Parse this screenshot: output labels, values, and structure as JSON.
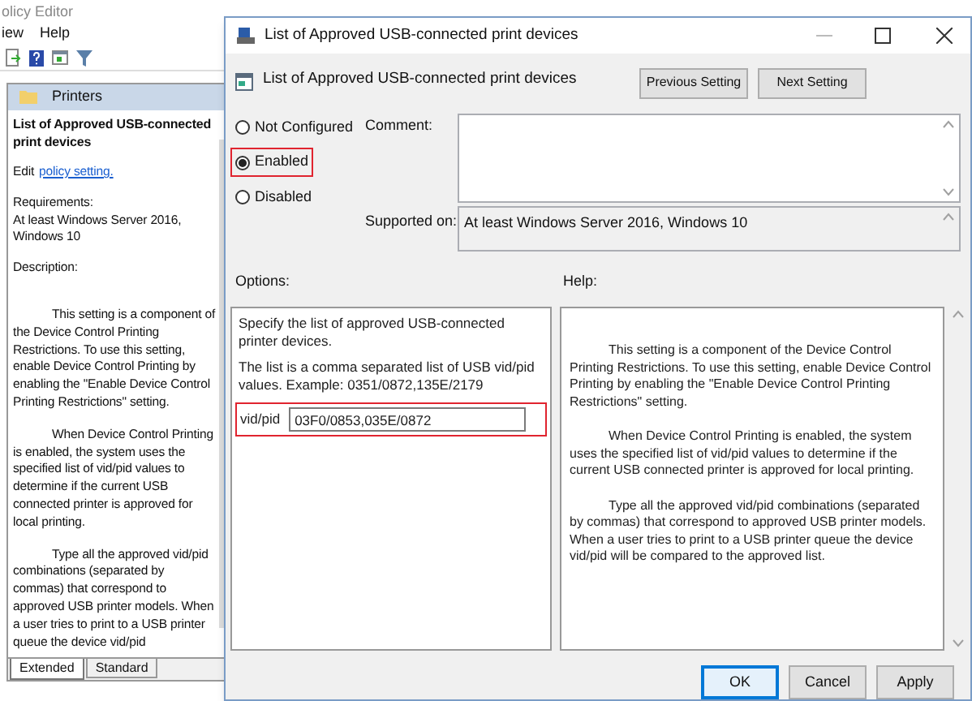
{
  "back_window": {
    "title": "olicy Editor",
    "menu": [
      "iew",
      "Help"
    ],
    "folder": "Printers",
    "heading": "List of Approved USB-connected print devices",
    "edit_prefix": "Edit",
    "edit_link": "policy setting.",
    "requirements_label": "Requirements:",
    "requirements": "At least Windows Server 2016, Windows 10",
    "description_label": "Description:",
    "description": [
      "This setting is a component of the Device Control Printing Restrictions. To use this setting, enable Device Control Printing by enabling the \"Enable Device Control Printing Restrictions\" setting.",
      "When Device Control Printing is enabled, the system uses the specified list of vid/pid values to determine if the current USB connected printer is approved for local printing.",
      "Type all the approved vid/pid combinations (separated by commas) that correspond to approved USB printer models. When a user tries to print to a USB printer queue the device vid/pid"
    ],
    "tabs": [
      {
        "label": "Extended",
        "selected": true
      },
      {
        "label": "Standard",
        "selected": false
      }
    ]
  },
  "dialog": {
    "title": "List of Approved USB-connected print devices",
    "setting_name": "List of Approved USB-connected print devices",
    "nav_buttons": [
      "Previous Setting",
      "Next Setting"
    ],
    "options": [
      {
        "label": "Not Configured",
        "selected": false,
        "highlighted": false
      },
      {
        "label": "Enabled",
        "selected": true,
        "highlighted": true
      },
      {
        "label": "Disabled",
        "selected": false,
        "highlighted": false
      }
    ],
    "comment_label": "Comment:",
    "supported_label": "Supported on:",
    "supported_value": "At least Windows Server 2016, Windows 10",
    "options_label": "Options:",
    "help_label": "Help:",
    "options_text": [
      "Specify the list of approved USB-connected printer devices.",
      "The list is a comma separated list of USB vid/pid values. Example: 0351/0872,135E/2179"
    ],
    "field": {
      "label": "vid/pid",
      "value": "03F0/0853,035E/0872",
      "highlighted": true
    },
    "help_text": [
      "This setting is a component of the Device Control Printing Restrictions. To use this setting, enable Device Control Printing by enabling the \"Enable Device Control Printing Restrictions\" setting.",
      "When Device Control Printing is enabled, the system uses the specified list of vid/pid values to determine if the current USB connected printer is approved for local printing.",
      "Type all the approved vid/pid combinations (separated by commas) that correspond to approved USB printer models. When a user tries to print to a USB printer queue the device vid/pid will be compared to the approved list."
    ],
    "buttons": [
      {
        "label": "OK",
        "kind": "default"
      },
      {
        "label": "Cancel",
        "kind": "normal"
      },
      {
        "label": "Apply",
        "kind": "normal"
      }
    ]
  }
}
